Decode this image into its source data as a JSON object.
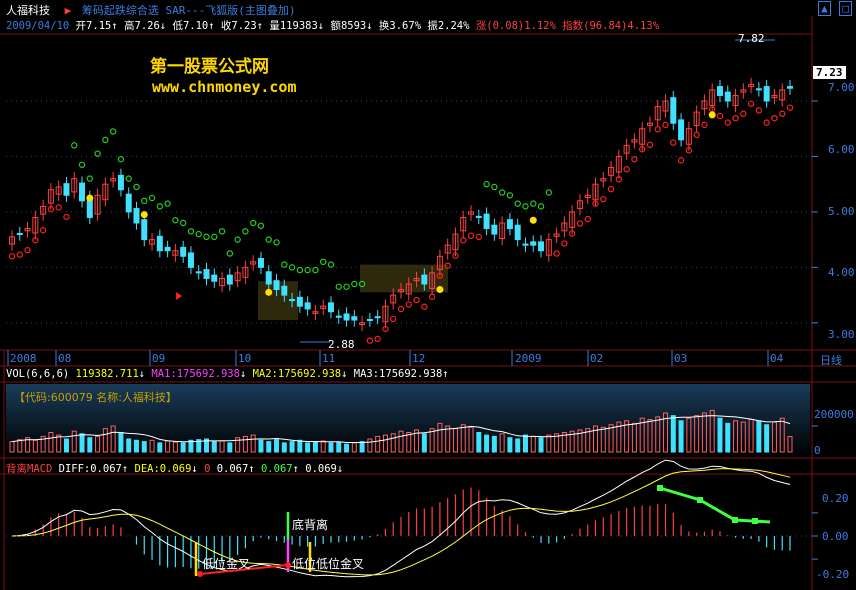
{
  "title_bar": {
    "stock_name": "人福科技",
    "indicator_title": "筹码起跌综合选 SAR---飞狐版(主图叠加)",
    "buttons": [
      "▲",
      "□"
    ]
  },
  "quote_line": {
    "date": "2009/04/10",
    "open": "开7.15",
    "high": "高7.26",
    "low": "低7.10",
    "close": "收7.23",
    "volume": "量119383",
    "amount": "额8593",
    "turnover": "换3.67%",
    "amplitude": "振2.24%",
    "change": "涨(0.08)1.12%",
    "index": "指数(96.84)4.13%"
  },
  "watermark": {
    "line1": "第一股票公式网",
    "line2": "www.chnmoney.com"
  },
  "main_chart": {
    "high_label": "7.82",
    "low_label": "2.88",
    "price_tag": "7.23",
    "y_ticks": [
      "7.00",
      "6.00",
      "5.00",
      "4.00",
      "3.00"
    ],
    "icons": [
      "buy-arrow-icon",
      "sar-dot-icon"
    ]
  },
  "time_axis": {
    "labels": [
      "2008",
      "08",
      "09",
      "10",
      "11",
      "12",
      "2009",
      "02",
      "03",
      "04"
    ],
    "period": "日线"
  },
  "volume_panel": {
    "header_name": "VOL(6,6,6)",
    "vol": "119382.711",
    "ma1": "MA1:175692.938",
    "ma2": "MA2:175692.938",
    "ma3": "MA3:175692.938",
    "code_info": "【代码:600079 名称:人福科技】",
    "y_ticks": [
      "200000",
      "0"
    ]
  },
  "macd_panel": {
    "name": "背离MACD",
    "diff": "DIFF:0.067",
    "dea": "DEA:0.069",
    "v1": "0",
    "v2": "0.067",
    "v3": "0.067",
    "v4": "0.069",
    "label_bottom_div": "底背离",
    "label_low_cross": "低位金叉",
    "label_low_cross2": "低位低位金叉",
    "y_ticks": [
      "0.20",
      "0.00",
      "-0.20"
    ]
  },
  "colors": {
    "up": "#ff4040",
    "down": "#40e0ff",
    "axis": "#3a7de0",
    "sar_red": "#ff2020",
    "sar_green": "#20d020"
  },
  "chart_data": {
    "type": "candlestick",
    "closes": [
      4.55,
      4.6,
      4.7,
      4.9,
      5.1,
      5.4,
      5.45,
      5.3,
      5.6,
      5.2,
      4.9,
      5.3,
      5.5,
      5.6,
      5.4,
      5.0,
      4.8,
      4.5,
      4.5,
      4.3,
      4.3,
      4.3,
      4.2,
      4.0,
      3.9,
      3.8,
      3.75,
      3.8,
      3.7,
      3.9,
      4.0,
      4.1,
      4.0,
      3.7,
      3.6,
      3.5,
      3.4,
      3.3,
      3.25,
      3.2,
      3.3,
      3.2,
      3.1,
      3.05,
      3.05,
      3.0,
      3.05,
      3.1,
      3.3,
      3.5,
      3.6,
      3.7,
      3.8,
      3.7,
      3.9,
      4.2,
      4.4,
      4.6,
      4.9,
      5.0,
      4.9,
      4.7,
      4.6,
      4.8,
      4.7,
      4.5,
      4.4,
      4.4,
      4.3,
      4.5,
      4.6,
      4.8,
      5.0,
      5.2,
      5.3,
      5.5,
      5.6,
      5.8,
      6.0,
      6.2,
      6.3,
      6.5,
      6.6,
      6.9,
      7.0,
      6.6,
      6.3,
      6.5,
      6.8,
      7.0,
      7.2,
      7.1,
      7.0,
      7.1,
      7.2,
      7.3,
      7.2,
      7.0,
      7.1,
      7.2,
      7.23
    ],
    "ylim": [
      2.6,
      8.1
    ],
    "volume": [
      80,
      95,
      110,
      90,
      120,
      150,
      130,
      100,
      160,
      140,
      110,
      120,
      180,
      200,
      150,
      100,
      90,
      80,
      90,
      70,
      85,
      75,
      70,
      90,
      95,
      100,
      80,
      85,
      70,
      110,
      120,
      130,
      90,
      80,
      95,
      70,
      80,
      90,
      70,
      80,
      85,
      70,
      75,
      60,
      70,
      80,
      100,
      120,
      130,
      140,
      160,
      150,
      170,
      140,
      180,
      220,
      200,
      180,
      210,
      190,
      150,
      130,
      120,
      140,
      110,
      100,
      130,
      120,
      110,
      130,
      140,
      150,
      160,
      170,
      180,
      200,
      190,
      210,
      230,
      240,
      220,
      260,
      250,
      270,
      300,
      280,
      240,
      260,
      280,
      300,
      320,
      260,
      220,
      240,
      230,
      250,
      240,
      210,
      230,
      260,
      119
    ],
    "vol_ylim": [
      0,
      400
    ],
    "macd_ylim": [
      -0.45,
      0.45
    ]
  }
}
